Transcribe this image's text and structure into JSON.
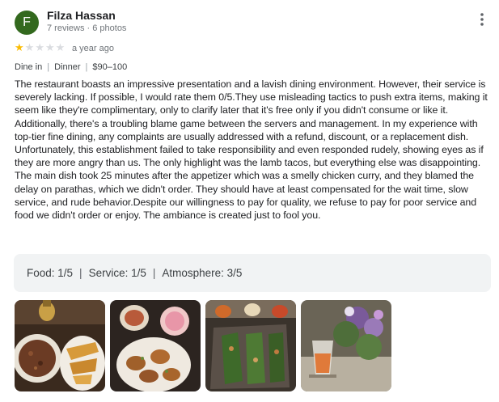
{
  "reviewer": {
    "initial": "F",
    "name": "Filza Hassan",
    "meta": "7 reviews · 6 photos"
  },
  "rating": {
    "stars": 1,
    "out_of": 5,
    "time": "a year ago"
  },
  "tags": [
    "Dine in",
    "Dinner",
    "$90–100"
  ],
  "text": "The restaurant boasts an impressive presentation and a lavish dining environment. However, their service is severely lacking. If possible, I would rate them 0/5.They use misleading tactics to push extra items, making it seem like they're complimentary, only to clarify later that it's free only if you didn't consume or like it. Additionally, there's a troubling blame game between the servers and management. In my experience with top-tier fine dining, any complaints are usually addressed with a refund, discount, or a replacement dish. Unfortunately, this establishment failed to take responsibility and even responded rudely, showing eyes as if they are more angry than us. The only highlight was the lamb tacos, but everything else was disappointing. The main dish took 25 minutes after the appetizer which was a smelly chicken curry, and they blamed the delay on parathas, which we didn't order. They should have at least compensated for the wait time, slow service, and rude behavior.Despite our willingness to pay for quality, we refuse to pay for poor service and food we didn't order or enjoy. The ambiance is created just to fool you.",
  "sub_ratings": {
    "food": "Food: 1/5",
    "service": "Service: 1/5",
    "atmosphere": "Atmosphere: 3/5",
    "separator": "|"
  },
  "tag_separator": "|",
  "photos_count": 4,
  "colors": {
    "avatar": "#33691e",
    "star_filled": "#fbbc04",
    "star_empty": "#dadce0",
    "ratings_bg": "#f1f3f4"
  }
}
